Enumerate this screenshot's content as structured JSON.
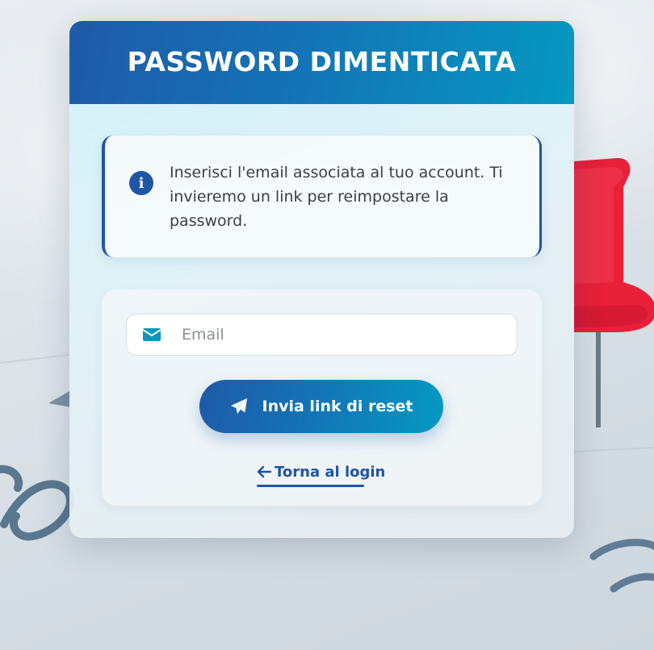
{
  "page": {
    "title": "PASSWORD DIMENTICATA"
  },
  "info": {
    "icon": "info-circle-icon",
    "text": "Inserisci l'email associata al tuo account. Ti invieremo un link per reimpostare la password."
  },
  "form": {
    "email": {
      "icon": "envelope-icon",
      "placeholder": "Email",
      "value": ""
    },
    "submit": {
      "icon": "paper-plane-icon",
      "label": "Invia link di reset"
    },
    "back_link": {
      "icon": "arrow-left-icon",
      "label": "Torna al login"
    }
  },
  "colors": {
    "primary": "#1f55a4",
    "accent": "#0598c2",
    "pin_red": "#e8203a"
  }
}
